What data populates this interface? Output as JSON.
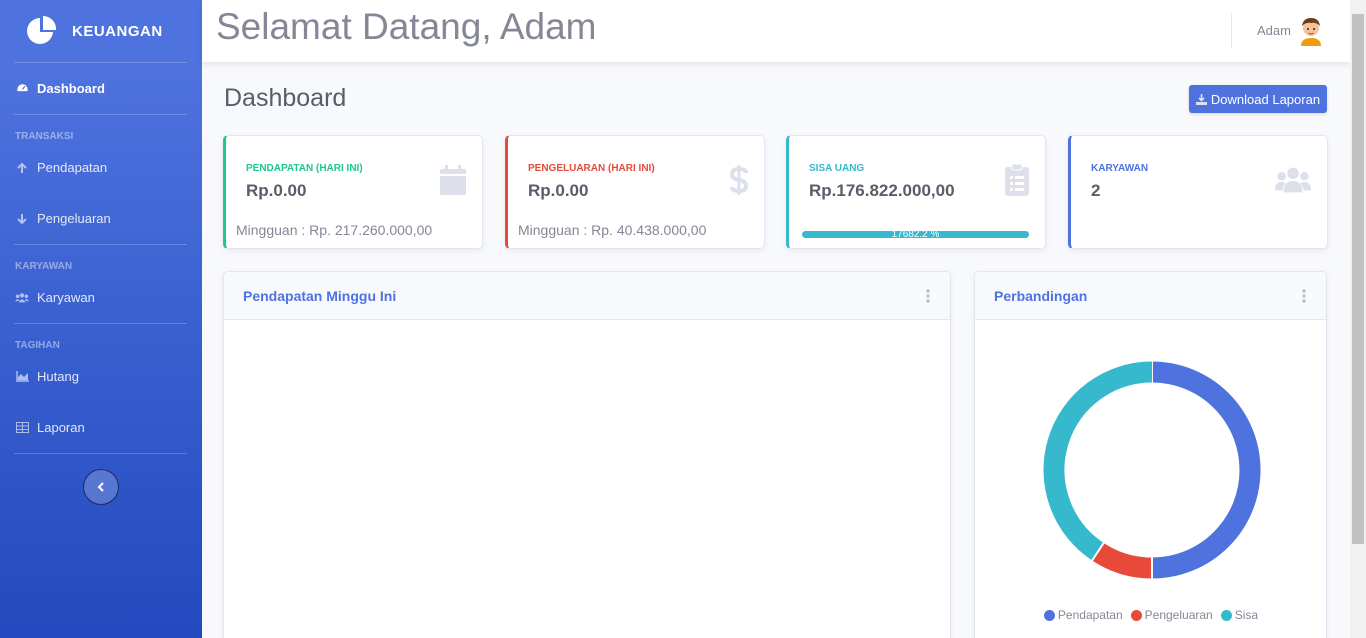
{
  "brand": {
    "name": "KEUANGAN"
  },
  "sidebar": {
    "dashboard": "Dashboard",
    "headings": {
      "transaksi": "TRANSAKSI",
      "karyawan": "KARYAWAN",
      "tagihan": "TAGIHAN"
    },
    "items": {
      "pendapatan": "Pendapatan",
      "pengeluaran": "Pengeluaran",
      "karyawan": "Karyawan",
      "hutang": "Hutang",
      "laporan": "Laporan"
    }
  },
  "topbar": {
    "welcome": "Selamat Datang, Adam",
    "username": "Adam"
  },
  "page": {
    "title": "Dashboard",
    "download_label": "Download Laporan"
  },
  "cards": {
    "pendapatan": {
      "label": "PENDAPATAN (HARI INI)",
      "value": "Rp.0.00",
      "sub": "Mingguan : Rp. 217.260.000,00",
      "color": "#1cc88a",
      "icon": "calendar-icon"
    },
    "pengeluaran": {
      "label": "PENGELUARAN (HARI INI)",
      "value": "Rp.0.00",
      "sub": "Mingguan : Rp. 40.438.000,00",
      "color": "#e74a3b",
      "icon": "dollar-icon"
    },
    "sisa": {
      "label": "SISA UANG",
      "value": "Rp.176.822.000,00",
      "progress_text": "17682.2 %",
      "progress_fraction": 1.0,
      "color": "#36b9cc",
      "icon": "clipboard-icon"
    },
    "karyawan": {
      "label": "KARYAWAN",
      "value": "2",
      "color": "#4e73df",
      "icon": "users-icon"
    }
  },
  "panels": {
    "weekly": {
      "title": "Pendapatan Minggu Ini"
    },
    "compare": {
      "title": "Perbandingan"
    }
  },
  "chart_data": {
    "type": "pie",
    "categories": [
      "Pendapatan",
      "Pengeluaran",
      "Sisa"
    ],
    "values": [
      217260000,
      40438000,
      176822000
    ],
    "colors": [
      "#4e73df",
      "#e74a3b",
      "#36b9cc"
    ],
    "legend_position": "bottom",
    "donut": true
  }
}
